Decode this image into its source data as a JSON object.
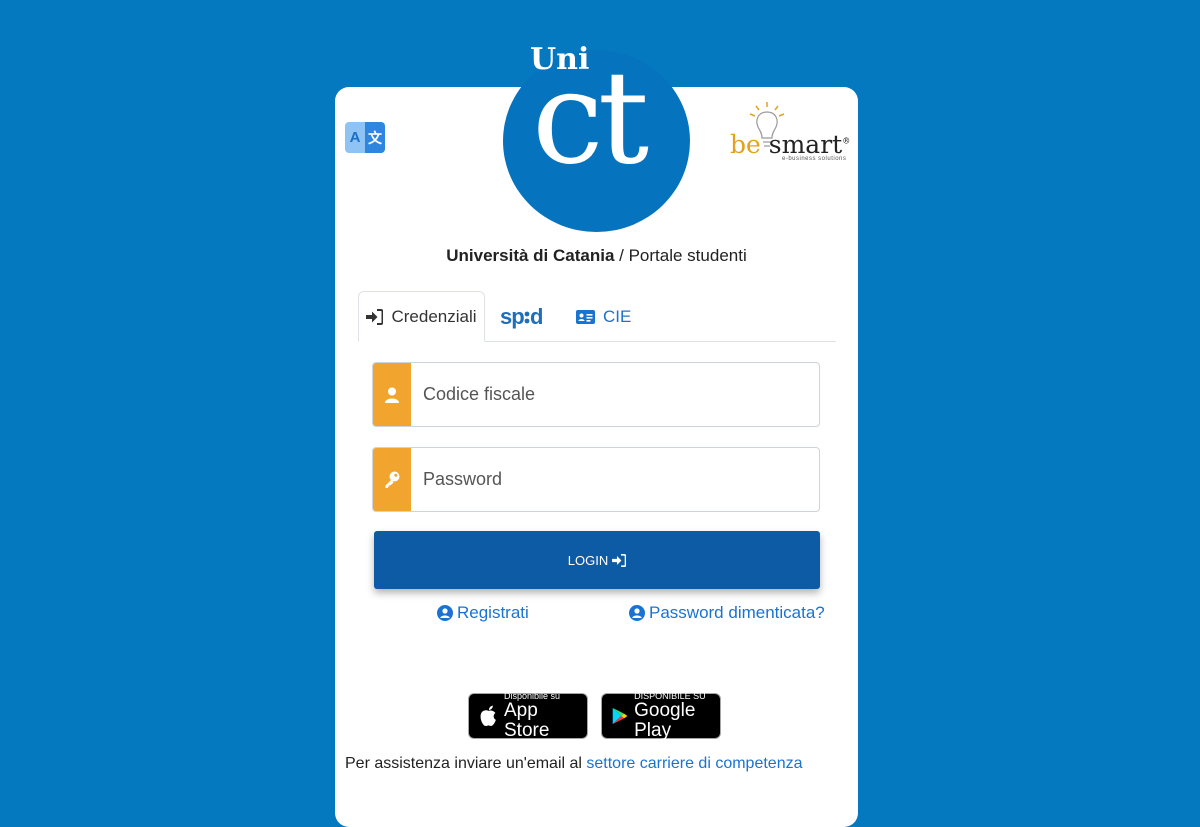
{
  "colors": {
    "background": "#0579c0",
    "card": "#ffffff",
    "logo": "#0573bd",
    "accent_addon": "#f2a52e",
    "login_button": "#0d5aa5",
    "link": "#1a73d0"
  },
  "logo": {
    "top_text": "Uni",
    "main_text": "ct"
  },
  "translate_button": {
    "left_letter": "A",
    "right_glyph": "文"
  },
  "partner_logo": {
    "be": "be",
    "smart": "smart",
    "tagline": "e-business solutions"
  },
  "header": {
    "university": "Università di Catania",
    "separator": " / ",
    "portal": "Portale studenti"
  },
  "tabs": [
    {
      "label": "Credenziali",
      "icon": "sign-in-icon",
      "active": true
    },
    {
      "label": "spid",
      "icon": "spid-logo",
      "active": false
    },
    {
      "label": "CIE",
      "icon": "id-card-icon",
      "active": false
    }
  ],
  "form": {
    "codice_fiscale": {
      "placeholder": "Codice fiscale",
      "value": "",
      "icon": "user-icon"
    },
    "password": {
      "placeholder": "Password",
      "value": "",
      "icon": "key-icon"
    },
    "login_label": "LOGIN"
  },
  "links": {
    "register": "Registrati",
    "forgot_password": "Password dimenticata?"
  },
  "stores": {
    "app_store": {
      "small": "Disponibile su",
      "big": "App Store"
    },
    "google_play": {
      "small": "DISPONIBILE SU",
      "big": "Google Play"
    }
  },
  "footer": {
    "text": "Per assistenza inviare un'email al ",
    "link": "settore carriere di competenza"
  }
}
